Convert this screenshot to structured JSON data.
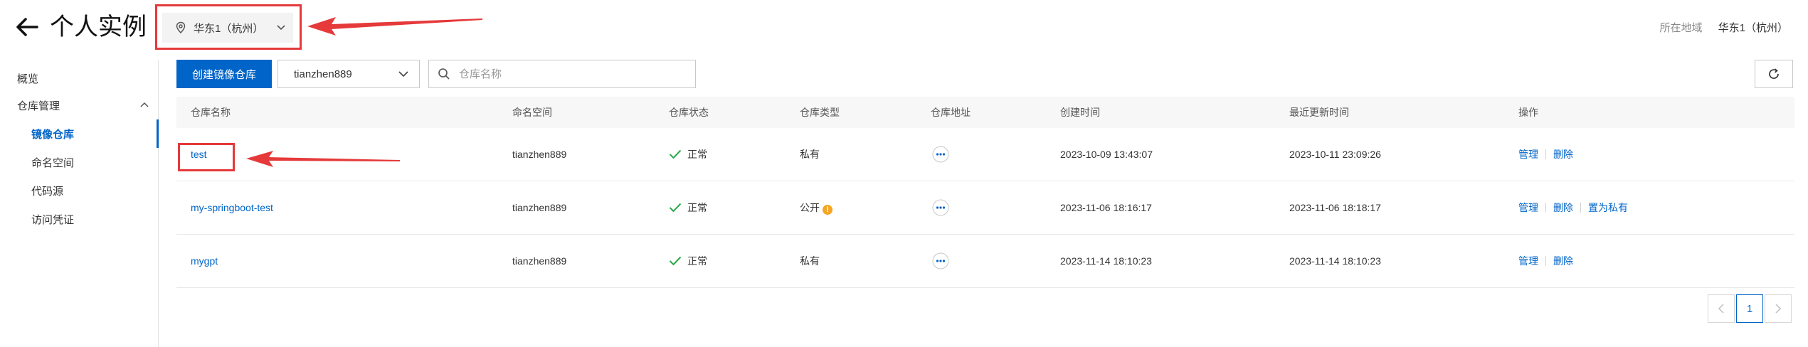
{
  "header": {
    "title": "个人实例",
    "region_selected": "华东1（杭州）",
    "region_label": "所在地域",
    "region_value": "华东1（杭州）"
  },
  "sidebar": {
    "items": [
      {
        "label": "概览"
      },
      {
        "label": "仓库管理"
      },
      {
        "label": "镜像仓库"
      },
      {
        "label": "命名空间"
      },
      {
        "label": "代码源"
      },
      {
        "label": "访问凭证"
      }
    ]
  },
  "toolbar": {
    "create_label": "创建镜像仓库",
    "namespace_value": "tianzhen889",
    "search_placeholder": "仓库名称"
  },
  "table": {
    "columns": [
      "仓库名称",
      "命名空间",
      "仓库状态",
      "仓库类型",
      "仓库地址",
      "创建时间",
      "最近更新时间",
      "操作"
    ],
    "rows": [
      {
        "name": "test",
        "namespace": "tianzhen889",
        "status": "正常",
        "type": "私有",
        "created": "2023-10-09 13:43:07",
        "updated": "2023-10-11 23:09:26",
        "actions": [
          "管理",
          "删除"
        ]
      },
      {
        "name": "my-springboot-test",
        "namespace": "tianzhen889",
        "status": "正常",
        "type": "公开",
        "created": "2023-11-06 18:16:17",
        "updated": "2023-11-06 18:18:17",
        "actions": [
          "管理",
          "删除",
          "置为私有"
        ]
      },
      {
        "name": "mygpt",
        "namespace": "tianzhen889",
        "status": "正常",
        "type": "私有",
        "created": "2023-11-14 18:10:23",
        "updated": "2023-11-14 18:10:23",
        "actions": [
          "管理",
          "删除"
        ]
      }
    ]
  },
  "pagination": {
    "current": "1"
  },
  "colors": {
    "accent": "#0064c8",
    "annotation": "#e5393a",
    "ok": "#2aa84a",
    "warn": "#f5a623"
  },
  "icons": [
    "back-arrow-icon",
    "location-icon",
    "chevron-down-icon",
    "chevron-up-icon",
    "search-icon",
    "refresh-icon",
    "check-icon",
    "more-icon",
    "warning-icon",
    "chevron-left-icon",
    "chevron-right-icon"
  ]
}
